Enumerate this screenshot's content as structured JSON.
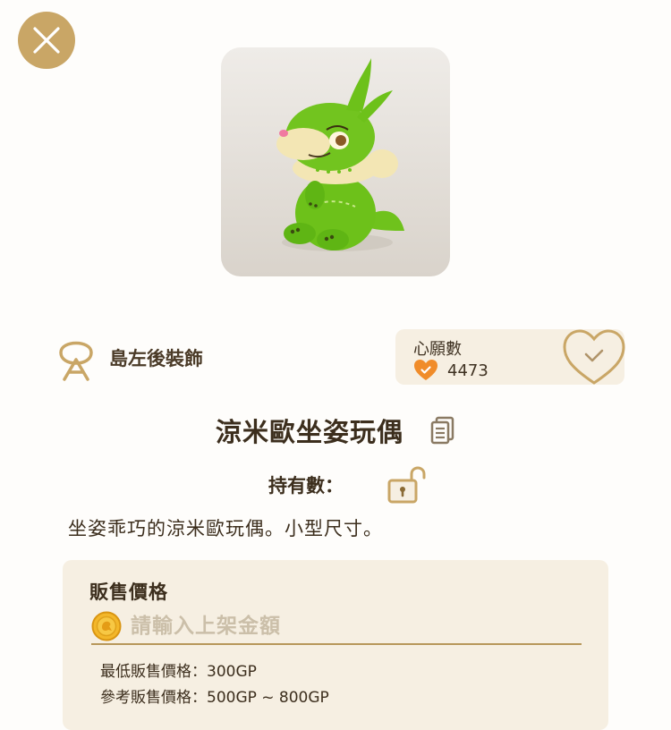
{
  "category": {
    "label": "島左後裝飾"
  },
  "wishlist": {
    "title": "心願數",
    "count": "4473"
  },
  "item": {
    "name": "涼米歐坐姿玩偶",
    "owned_label": "持有數：",
    "description": "坐姿乖巧的涼米歐玩偶。小型尺寸。"
  },
  "sale": {
    "title": "販售價格",
    "price_placeholder": "請輸入上架金額",
    "min_price": "最低販售價格：300GP",
    "ref_price": "參考販售價格：500GP ~ 800GP"
  },
  "colors": {
    "accent_gold": "#c9a666",
    "panel_beige": "#f6efe2",
    "heart_orange": "#f08c2a",
    "text_brown": "#3c2e1d"
  },
  "icons": {
    "close": "close-icon",
    "category": "hairpin-icon",
    "heart": "heart-icon",
    "wish_heart": "heart-check-icon",
    "copy": "copy-icon",
    "lock": "unlocked-padlock-icon",
    "coin": "gold-coin-icon"
  }
}
